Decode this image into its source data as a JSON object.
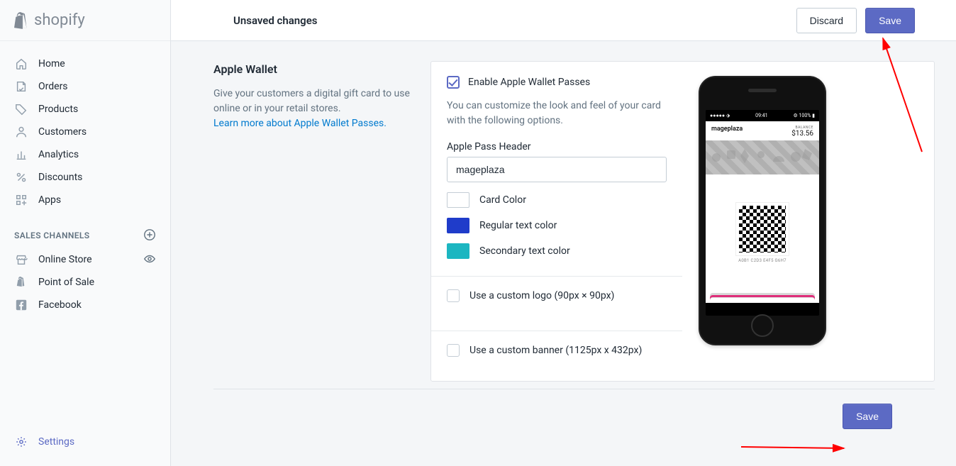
{
  "brand": "shopify",
  "topbar": {
    "title": "Unsaved changes",
    "discard_label": "Discard",
    "save_label": "Save"
  },
  "sidebar": {
    "items": [
      {
        "label": "Home"
      },
      {
        "label": "Orders"
      },
      {
        "label": "Products"
      },
      {
        "label": "Customers"
      },
      {
        "label": "Analytics"
      },
      {
        "label": "Discounts"
      },
      {
        "label": "Apps"
      }
    ],
    "channels_title": "SALES CHANNELS",
    "channels": [
      {
        "label": "Online Store"
      },
      {
        "label": "Point of Sale"
      },
      {
        "label": "Facebook"
      }
    ],
    "settings_label": "Settings"
  },
  "section": {
    "title": "Apple Wallet",
    "description": "Give your customers a digital gift card to use online or in your retail stores.",
    "learn_more": "Learn more about Apple Wallet Passes."
  },
  "card": {
    "enable_label": "Enable Apple Wallet Passes",
    "customize_help": "You can customize the look and feel of your card with the following options.",
    "header_label": "Apple Pass Header",
    "header_value": "mageplaza",
    "swatches": {
      "card_color": "Card Color",
      "regular_text": "Regular text color",
      "secondary_text": "Secondary text color"
    },
    "colors": {
      "card": "#ffffff",
      "regular": "#1f3cca",
      "secondary": "#1cb6c1"
    },
    "logo_label": "Use a custom logo (90px × 90px)",
    "banner_label": "Use a custom banner (1125px x 432px)"
  },
  "preview": {
    "status_left": "●●●●● ⬗",
    "status_center": "09:41",
    "status_right": "⚙ 100% ▮",
    "header_name": "mageplaza",
    "balance_label": "BALANCE",
    "balance_value": "$13.56",
    "qr_code_text": "A0B1 C2D3 E4F5 G6H7"
  },
  "bottom": {
    "save_label": "Save"
  }
}
